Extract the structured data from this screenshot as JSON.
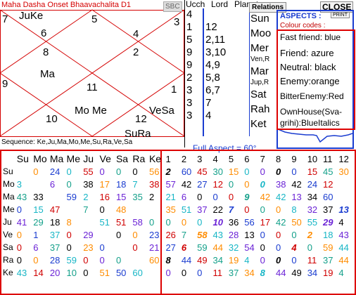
{
  "window": {
    "title": "Maha Dasha Onset Bhaavachalita D1",
    "sbc_label": "SBC",
    "relations_label": "Relations",
    "close_label": "CLOSE",
    "print_label": "PRINT"
  },
  "chart": {
    "cells": {
      "h12": "JuKe",
      "h1": "",
      "h2": "",
      "h3": "",
      "h4": "Mo Me",
      "h5": "",
      "h6": "VeSa",
      "h7": "SuRa",
      "h8": "",
      "h9": "",
      "h10": "Ma",
      "h11": ""
    },
    "numbers": {
      "n7": "7",
      "n5": "5",
      "n3": "3",
      "n6": "6",
      "n4": "4",
      "n8": "8",
      "n2": "2",
      "n11": "11",
      "n9": "9",
      "n1": "1",
      "n10": "10",
      "n12": "12"
    },
    "sequence": "Sequence: Ke,Ju,Ma,Mo,Me,Su,Ra,Ve,Sa"
  },
  "planet_table": {
    "ucch_header": "Ucch",
    "lord_header": "Lord",
    "planet_header": "Planet",
    "ucch": [
      "4",
      "1",
      "5",
      "9",
      "9",
      "2",
      "3",
      "3",
      "3"
    ],
    "lord": [
      "12",
      "2,11",
      "3,10",
      "4,9",
      "5,8",
      "6,7",
      "7",
      "4"
    ],
    "planets": [
      "Sun",
      "Moo",
      "Mer",
      "Ven,R",
      "Mar",
      "Jup,R",
      "Sat",
      "Rah",
      "Ket"
    ]
  },
  "aspects": {
    "title": "ASPECTS :",
    "colour_codes": "Colour codes :",
    "legend": [
      {
        "text": "Fast friend: blue",
        "color": "#000000"
      },
      {
        "text": "Friend: azure",
        "color": "#000000"
      },
      {
        "text": "Neutral: black",
        "color": "#000000"
      },
      {
        "text": "Enemy:orange",
        "color": "#000000"
      },
      {
        "text": "BitterEnemy:Red",
        "color": "#000000"
      },
      {
        "text": "OwnHouse(Sva-",
        "color": "#000000"
      },
      {
        "text": "grihi):BlueItalics",
        "color": "#000000"
      }
    ]
  },
  "full_aspect_label": "Full Aspect = 60°",
  "grid": {
    "planet_headers": [
      "Su",
      "Mo",
      "Ma",
      "Me",
      "Ju",
      "Ve",
      "Sa",
      "Ra",
      "Ke"
    ],
    "house_headers": [
      "1",
      "2",
      "3",
      "4",
      "5",
      "6",
      "7",
      "8",
      "9",
      "10",
      "11",
      "12"
    ],
    "rows": [
      {
        "label": "Su",
        "left": [
          "0",
          "24",
          "0",
          "55",
          "0",
          "0",
          "0",
          "56"
        ],
        "right": [
          "2",
          "60",
          "45",
          "30",
          "15",
          "0",
          "0",
          "0",
          "0",
          "15",
          "45",
          "30"
        ]
      },
      {
        "label": "Mo",
        "left": [
          "3",
          "6",
          "0",
          "38",
          "17",
          "18",
          "7",
          "38"
        ],
        "right": [
          "57",
          "42",
          "27",
          "12",
          "0",
          "0",
          "0",
          "38",
          "42",
          "24",
          "12",
          ""
        ]
      },
      {
        "label": "Ma",
        "left": [
          "43",
          "33",
          "59",
          "2",
          "16",
          "15",
          "35",
          "2"
        ],
        "right": [
          "21",
          "6",
          "0",
          "0",
          "0",
          "9",
          "42",
          "42",
          "13",
          "34",
          "60",
          ""
        ]
      },
      {
        "label": "Me",
        "left": [
          "0",
          "15",
          "47",
          "7",
          "0",
          "48",
          "",
          ""
        ],
        "right": [
          "35",
          "51",
          "37",
          "22",
          "7",
          "0",
          "0",
          "0",
          "8",
          "32",
          "37",
          "13"
        ]
      },
      {
        "label": "Ju",
        "left": [
          "41",
          "29",
          "18",
          "8",
          "51",
          "51",
          "58",
          "0"
        ],
        "right": [
          "0",
          "0",
          "0",
          "10",
          "36",
          "56",
          "17",
          "42",
          "50",
          "55",
          "29",
          "4"
        ]
      },
      {
        "label": "Ve",
        "left": [
          "0",
          "1",
          "37",
          "0",
          "29",
          "0",
          "0",
          "23"
        ],
        "right": [
          "26",
          "7",
          "58",
          "43",
          "28",
          "13",
          "0",
          "0",
          "0",
          "2",
          "18",
          "43"
        ]
      },
      {
        "label": "Sa",
        "left": [
          "0",
          "6",
          "37",
          "0",
          "23",
          "0",
          "0",
          "21"
        ],
        "right": [
          "27",
          "6",
          "59",
          "44",
          "32",
          "54",
          "0",
          "0",
          "4",
          "0",
          "59",
          "44"
        ]
      },
      {
        "label": "Ra",
        "left": [
          "0",
          "0",
          "28",
          "59",
          "0",
          "0",
          "0",
          "60"
        ],
        "right": [
          "8",
          "44",
          "49",
          "34",
          "19",
          "4",
          "0",
          "0",
          "0",
          "11",
          "37",
          "44"
        ]
      },
      {
        "label": "Ke",
        "left": [
          "43",
          "14",
          "20",
          "10",
          "0",
          "51",
          "50",
          "60"
        ],
        "right": [
          "0",
          "0",
          "0",
          "11",
          "37",
          "34",
          "8",
          "44",
          "49",
          "34",
          "19",
          "4"
        ]
      }
    ]
  }
}
